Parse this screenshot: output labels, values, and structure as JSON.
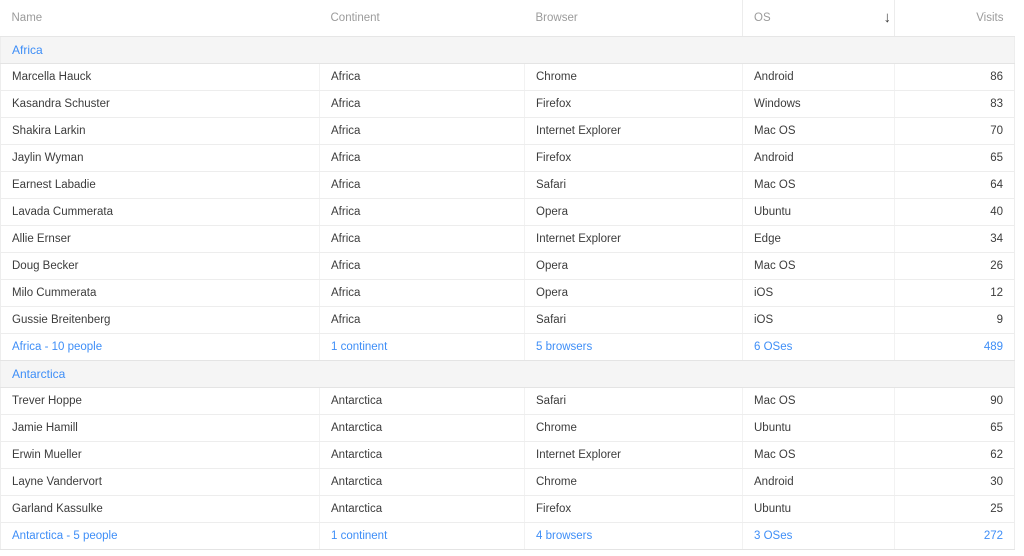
{
  "table": {
    "columns": [
      {
        "key": "name",
        "label": "Name",
        "align": "left"
      },
      {
        "key": "continent",
        "label": "Continent",
        "align": "left"
      },
      {
        "key": "browser",
        "label": "Browser",
        "align": "left"
      },
      {
        "key": "os",
        "label": "OS",
        "align": "left"
      },
      {
        "key": "sort",
        "label": "",
        "align": "center",
        "icon": "arrow-down-icon",
        "glyph": "↓"
      },
      {
        "key": "visits",
        "label": "Visits",
        "align": "right"
      }
    ],
    "sort": {
      "column": "Visits",
      "direction": "descending",
      "indicator_glyph": "↓"
    },
    "colors": {
      "link": "#3e8ef7",
      "header_text": "#9b9b9b",
      "body_text": "#3c3c3c",
      "group_background": "#f5f5f5",
      "row_border": "#ededed"
    },
    "groups": [
      {
        "title": "Africa",
        "rows": [
          {
            "name": "Marcella Hauck",
            "continent": "Africa",
            "browser": "Chrome",
            "os": "Android",
            "visits": "86"
          },
          {
            "name": "Kasandra Schuster",
            "continent": "Africa",
            "browser": "Firefox",
            "os": "Windows",
            "visits": "83"
          },
          {
            "name": "Shakira Larkin",
            "continent": "Africa",
            "browser": "Internet Explorer",
            "os": "Mac OS",
            "visits": "70"
          },
          {
            "name": "Jaylin Wyman",
            "continent": "Africa",
            "browser": "Firefox",
            "os": "Android",
            "visits": "65"
          },
          {
            "name": "Earnest Labadie",
            "continent": "Africa",
            "browser": "Safari",
            "os": "Mac OS",
            "visits": "64"
          },
          {
            "name": "Lavada Cummerata",
            "continent": "Africa",
            "browser": "Opera",
            "os": "Ubuntu",
            "visits": "40"
          },
          {
            "name": "Allie Ernser",
            "continent": "Africa",
            "browser": "Internet Explorer",
            "os": "Edge",
            "visits": "34"
          },
          {
            "name": "Doug Becker",
            "continent": "Africa",
            "browser": "Opera",
            "os": "Mac OS",
            "visits": "26"
          },
          {
            "name": "Milo Cummerata",
            "continent": "Africa",
            "browser": "Opera",
            "os": "iOS",
            "visits": "12"
          },
          {
            "name": "Gussie Breitenberg",
            "continent": "Africa",
            "browser": "Safari",
            "os": "iOS",
            "visits": "9"
          }
        ],
        "summary": {
          "name": "Africa - 10 people",
          "continent": "1 continent",
          "browser": "5 browsers",
          "os": "6 OSes",
          "visits": "489"
        }
      },
      {
        "title": "Antarctica",
        "rows": [
          {
            "name": "Trever Hoppe",
            "continent": "Antarctica",
            "browser": "Safari",
            "os": "Mac OS",
            "visits": "90"
          },
          {
            "name": "Jamie Hamill",
            "continent": "Antarctica",
            "browser": "Chrome",
            "os": "Ubuntu",
            "visits": "65"
          },
          {
            "name": "Erwin Mueller",
            "continent": "Antarctica",
            "browser": "Internet Explorer",
            "os": "Mac OS",
            "visits": "62"
          },
          {
            "name": "Layne Vandervort",
            "continent": "Antarctica",
            "browser": "Chrome",
            "os": "Android",
            "visits": "30"
          },
          {
            "name": "Garland Kassulke",
            "continent": "Antarctica",
            "browser": "Firefox",
            "os": "Ubuntu",
            "visits": "25"
          }
        ],
        "summary": {
          "name": "Antarctica - 5 people",
          "continent": "1 continent",
          "browser": "4 browsers",
          "os": "3 OSes",
          "visits": "272"
        }
      }
    ]
  }
}
